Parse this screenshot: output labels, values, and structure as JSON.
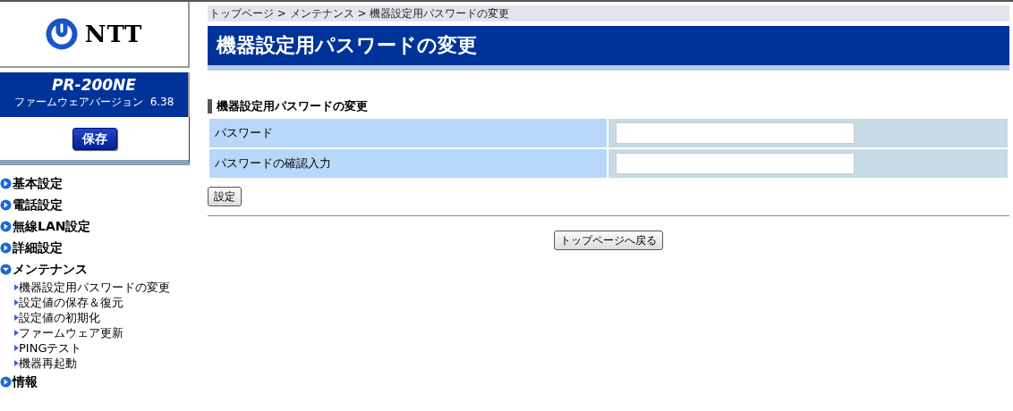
{
  "logo": {
    "text": "NTT"
  },
  "device": {
    "model": "PR-200NE",
    "firmware_label": "ファームウェアバージョン",
    "firmware_version": "6.38",
    "save_button": "保存"
  },
  "menu": [
    {
      "label": "基本設定",
      "expanded": false
    },
    {
      "label": "電話設定",
      "expanded": false
    },
    {
      "label": "無線LAN設定",
      "expanded": false
    },
    {
      "label": "詳細設定",
      "expanded": false
    },
    {
      "label": "メンテナンス",
      "expanded": true,
      "children": [
        {
          "label": "機器設定用パスワードの変更"
        },
        {
          "label": "設定値の保存＆復元"
        },
        {
          "label": "設定値の初期化"
        },
        {
          "label": "ファームウェア更新"
        },
        {
          "label": "PINGテスト"
        },
        {
          "label": "機器再起動"
        }
      ]
    },
    {
      "label": "情報",
      "expanded": false
    }
  ],
  "breadcrumb": "トップページ > メンテナンス > 機器設定用パスワードの変更",
  "page_title": "機器設定用パスワードの変更",
  "section_title": "機器設定用パスワードの変更",
  "form": [
    {
      "label": "パスワード"
    },
    {
      "label": "パスワードの確認入力"
    }
  ],
  "submit_button": "設定",
  "back_button": "トップページへ戻る"
}
